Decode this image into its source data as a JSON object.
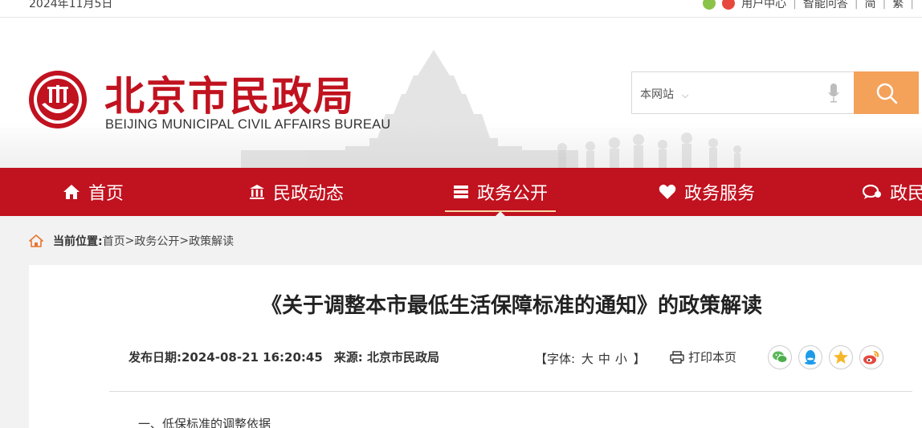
{
  "topbar": {
    "date": "2024年11月5日",
    "links": [
      "用户中心",
      "智能问答",
      "简",
      "繁"
    ]
  },
  "logo": {
    "cn": "北京市民政局",
    "en": "BEIJING MUNICIPAL CIVIL AFFAIRS BUREAU"
  },
  "search": {
    "scope": "本网站"
  },
  "nav": {
    "items": [
      {
        "label": "首页",
        "icon": "home-icon"
      },
      {
        "label": "民政动态",
        "icon": "building-icon"
      },
      {
        "label": "政务公开",
        "icon": "book-icon",
        "active": true
      },
      {
        "label": "政务服务",
        "icon": "heart-icon"
      },
      {
        "label": "政民互动",
        "icon": "chat-icon"
      }
    ]
  },
  "breadcrumb": {
    "label": "当前位置:",
    "items": [
      "首页",
      "政务公开",
      "政策解读"
    ],
    "separator": ">"
  },
  "article": {
    "title": "《关于调整本市最低生活保障标准的通知》的政策解读",
    "date_label": "发布日期:",
    "date": "2024-08-21 16:20:45",
    "source_label": "来源:",
    "source": "北京市民政局",
    "font_label_open": "【字体:",
    "font_sizes": [
      "大",
      "中",
      "小"
    ],
    "font_label_close": "】",
    "print_label": "打印本页",
    "share_icons": [
      "wechat-icon",
      "qq-icon",
      "qzone-icon",
      "weibo-icon"
    ],
    "section_heading": "一、低保标准的调整依据"
  },
  "colors": {
    "brand_red": "#c1121f",
    "search_orange": "#f4a15a",
    "page_bg": "#f2f2f2"
  }
}
